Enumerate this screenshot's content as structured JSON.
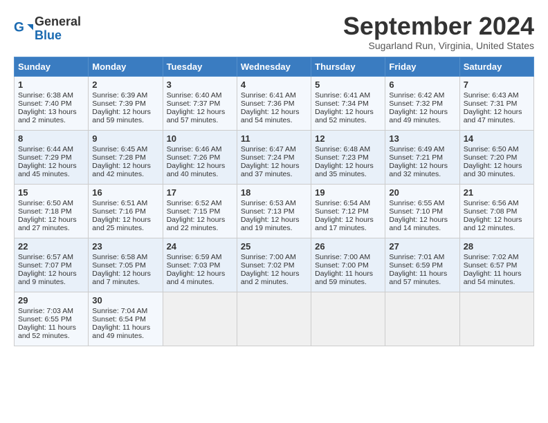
{
  "header": {
    "logo_line1": "General",
    "logo_line2": "Blue",
    "month": "September 2024",
    "location": "Sugarland Run, Virginia, United States"
  },
  "days_of_week": [
    "Sunday",
    "Monday",
    "Tuesday",
    "Wednesday",
    "Thursday",
    "Friday",
    "Saturday"
  ],
  "weeks": [
    [
      {
        "day": "1",
        "rise": "6:38 AM",
        "set": "7:40 PM",
        "daylight": "13 hours and 2 minutes."
      },
      {
        "day": "2",
        "rise": "6:39 AM",
        "set": "7:39 PM",
        "daylight": "12 hours and 59 minutes."
      },
      {
        "day": "3",
        "rise": "6:40 AM",
        "set": "7:37 PM",
        "daylight": "12 hours and 57 minutes."
      },
      {
        "day": "4",
        "rise": "6:41 AM",
        "set": "7:36 PM",
        "daylight": "12 hours and 54 minutes."
      },
      {
        "day": "5",
        "rise": "6:41 AM",
        "set": "7:34 PM",
        "daylight": "12 hours and 52 minutes."
      },
      {
        "day": "6",
        "rise": "6:42 AM",
        "set": "7:32 PM",
        "daylight": "12 hours and 49 minutes."
      },
      {
        "day": "7",
        "rise": "6:43 AM",
        "set": "7:31 PM",
        "daylight": "12 hours and 47 minutes."
      }
    ],
    [
      {
        "day": "8",
        "rise": "6:44 AM",
        "set": "7:29 PM",
        "daylight": "12 hours and 45 minutes."
      },
      {
        "day": "9",
        "rise": "6:45 AM",
        "set": "7:28 PM",
        "daylight": "12 hours and 42 minutes."
      },
      {
        "day": "10",
        "rise": "6:46 AM",
        "set": "7:26 PM",
        "daylight": "12 hours and 40 minutes."
      },
      {
        "day": "11",
        "rise": "6:47 AM",
        "set": "7:24 PM",
        "daylight": "12 hours and 37 minutes."
      },
      {
        "day": "12",
        "rise": "6:48 AM",
        "set": "7:23 PM",
        "daylight": "12 hours and 35 minutes."
      },
      {
        "day": "13",
        "rise": "6:49 AM",
        "set": "7:21 PM",
        "daylight": "12 hours and 32 minutes."
      },
      {
        "day": "14",
        "rise": "6:50 AM",
        "set": "7:20 PM",
        "daylight": "12 hours and 30 minutes."
      }
    ],
    [
      {
        "day": "15",
        "rise": "6:50 AM",
        "set": "7:18 PM",
        "daylight": "12 hours and 27 minutes."
      },
      {
        "day": "16",
        "rise": "6:51 AM",
        "set": "7:16 PM",
        "daylight": "12 hours and 25 minutes."
      },
      {
        "day": "17",
        "rise": "6:52 AM",
        "set": "7:15 PM",
        "daylight": "12 hours and 22 minutes."
      },
      {
        "day": "18",
        "rise": "6:53 AM",
        "set": "7:13 PM",
        "daylight": "12 hours and 19 minutes."
      },
      {
        "day": "19",
        "rise": "6:54 AM",
        "set": "7:12 PM",
        "daylight": "12 hours and 17 minutes."
      },
      {
        "day": "20",
        "rise": "6:55 AM",
        "set": "7:10 PM",
        "daylight": "12 hours and 14 minutes."
      },
      {
        "day": "21",
        "rise": "6:56 AM",
        "set": "7:08 PM",
        "daylight": "12 hours and 12 minutes."
      }
    ],
    [
      {
        "day": "22",
        "rise": "6:57 AM",
        "set": "7:07 PM",
        "daylight": "12 hours and 9 minutes."
      },
      {
        "day": "23",
        "rise": "6:58 AM",
        "set": "7:05 PM",
        "daylight": "12 hours and 7 minutes."
      },
      {
        "day": "24",
        "rise": "6:59 AM",
        "set": "7:03 PM",
        "daylight": "12 hours and 4 minutes."
      },
      {
        "day": "25",
        "rise": "7:00 AM",
        "set": "7:02 PM",
        "daylight": "12 hours and 2 minutes."
      },
      {
        "day": "26",
        "rise": "7:00 AM",
        "set": "7:00 PM",
        "daylight": "11 hours and 59 minutes."
      },
      {
        "day": "27",
        "rise": "7:01 AM",
        "set": "6:59 PM",
        "daylight": "11 hours and 57 minutes."
      },
      {
        "day": "28",
        "rise": "7:02 AM",
        "set": "6:57 PM",
        "daylight": "11 hours and 54 minutes."
      }
    ],
    [
      {
        "day": "29",
        "rise": "7:03 AM",
        "set": "6:55 PM",
        "daylight": "11 hours and 52 minutes."
      },
      {
        "day": "30",
        "rise": "7:04 AM",
        "set": "6:54 PM",
        "daylight": "11 hours and 49 minutes."
      },
      null,
      null,
      null,
      null,
      null
    ]
  ]
}
